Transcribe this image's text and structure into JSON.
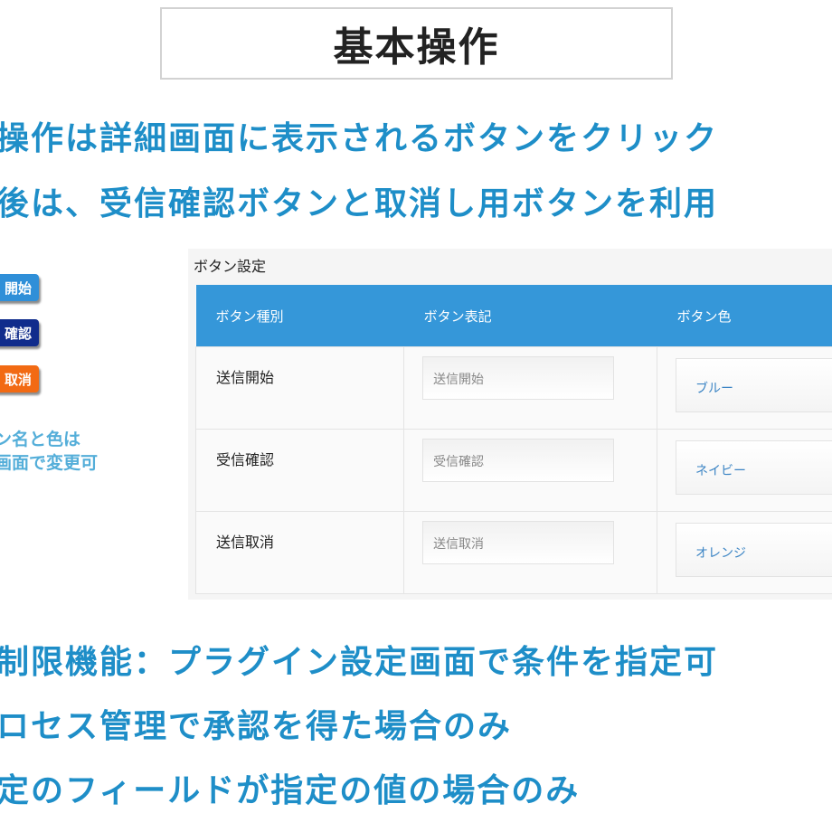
{
  "title": "基本操作",
  "headlines": {
    "line1": "操作は詳細画面に表示されるボタンをクリック",
    "line2": "後は、受信確認ボタンと取消し用ボタンを利用"
  },
  "sample_buttons": [
    {
      "label": "開始",
      "color": "#2f8fd8"
    },
    {
      "label": "確認",
      "color": "#102c8c"
    },
    {
      "label": "取消",
      "color": "#f26a13"
    }
  ],
  "left_note": {
    "line1": "ン名と色は",
    "line2": "画面で変更可"
  },
  "button_settings": {
    "title": "ボタン設定",
    "columns": [
      "ボタン種別",
      "ボタン表記",
      "ボタン色"
    ],
    "rows": [
      {
        "type": "送信開始",
        "label_value": "送信開始",
        "color": "ブルー"
      },
      {
        "type": "受信確認",
        "label_value": "受信確認",
        "color": "ネイビー"
      },
      {
        "type": "送信取消",
        "label_value": "送信取消",
        "color": "オレンジ"
      }
    ]
  },
  "bottom_lines": {
    "line1": "制限機能：プラグイン設定画面で条件を指定可",
    "line2": "ロセス管理で承認を得た場合のみ",
    "line3": "定のフィールドが指定の値の場合のみ"
  },
  "colors": {
    "accent": "#1e8ec8",
    "table_header": "#3597d9",
    "note": "#54aed9"
  }
}
